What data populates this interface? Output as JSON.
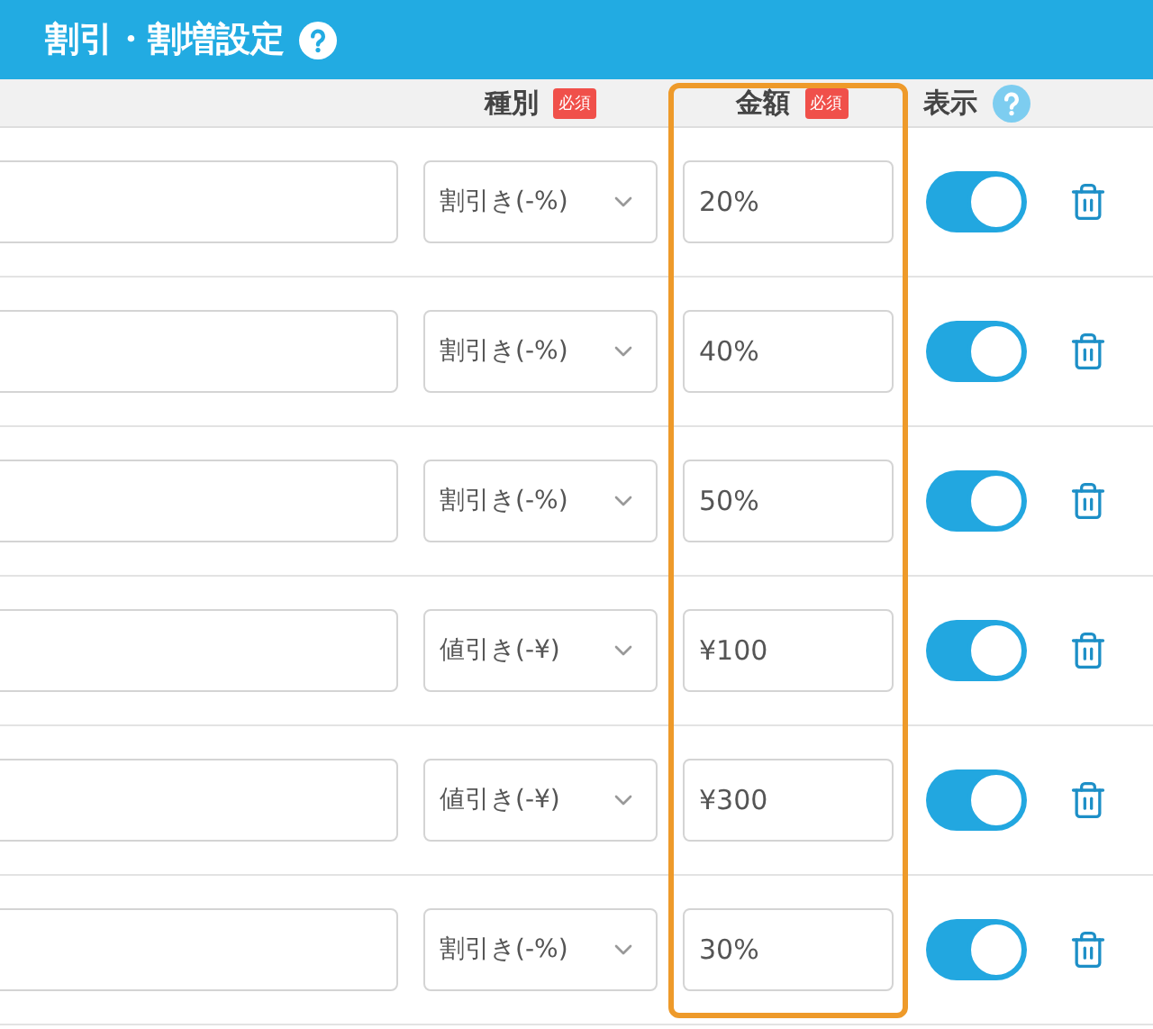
{
  "header": {
    "title": "割引・割増設定"
  },
  "columns": [
    {
      "label": "種別",
      "kind": "required",
      "badge": "必須",
      "highlighted": false
    },
    {
      "label": "金額",
      "kind": "required",
      "badge": "必須",
      "highlighted": true
    },
    {
      "label": "表示",
      "kind": "help",
      "highlighted": false
    }
  ],
  "rows": [
    {
      "type": "割引き(-%)",
      "amount": "20%",
      "visible": true
    },
    {
      "type": "割引き(-%)",
      "amount": "40%",
      "visible": true
    },
    {
      "type": "割引き(-%)",
      "amount": "50%",
      "visible": true
    },
    {
      "type": "値引き(-¥)",
      "amount": "¥100",
      "visible": true
    },
    {
      "type": "値引き(-¥)",
      "amount": "¥300",
      "visible": true
    },
    {
      "type": "割引き(-%)",
      "amount": "30%",
      "visible": true
    }
  ]
}
